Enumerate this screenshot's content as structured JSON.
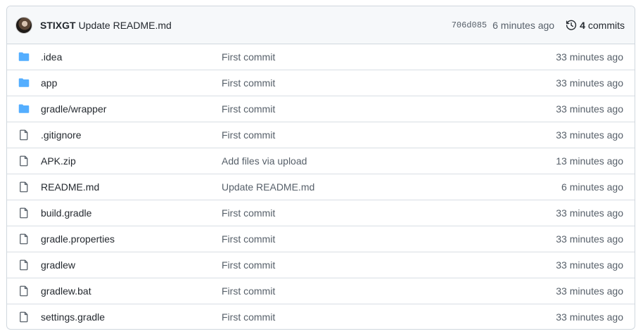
{
  "header": {
    "author": "STIXGT",
    "message": "Update README.md",
    "sha": "706d085",
    "time": "6 minutes ago",
    "commit_count": "4",
    "commit_label": "commits"
  },
  "colors": {
    "folder": "#54aeff",
    "file": "#57606a"
  },
  "files": [
    {
      "type": "folder",
      "name": ".idea",
      "message": "First commit",
      "age": "33 minutes ago"
    },
    {
      "type": "folder",
      "name": "app",
      "message": "First commit",
      "age": "33 minutes ago"
    },
    {
      "type": "folder",
      "name": "gradle/wrapper",
      "message": "First commit",
      "age": "33 minutes ago"
    },
    {
      "type": "file",
      "name": ".gitignore",
      "message": "First commit",
      "age": "33 minutes ago"
    },
    {
      "type": "file",
      "name": "APK.zip",
      "message": "Add files via upload",
      "age": "13 minutes ago"
    },
    {
      "type": "file",
      "name": "README.md",
      "message": "Update README.md",
      "age": "6 minutes ago"
    },
    {
      "type": "file",
      "name": "build.gradle",
      "message": "First commit",
      "age": "33 minutes ago"
    },
    {
      "type": "file",
      "name": "gradle.properties",
      "message": "First commit",
      "age": "33 minutes ago"
    },
    {
      "type": "file",
      "name": "gradlew",
      "message": "First commit",
      "age": "33 minutes ago"
    },
    {
      "type": "file",
      "name": "gradlew.bat",
      "message": "First commit",
      "age": "33 minutes ago"
    },
    {
      "type": "file",
      "name": "settings.gradle",
      "message": "First commit",
      "age": "33 minutes ago"
    }
  ]
}
